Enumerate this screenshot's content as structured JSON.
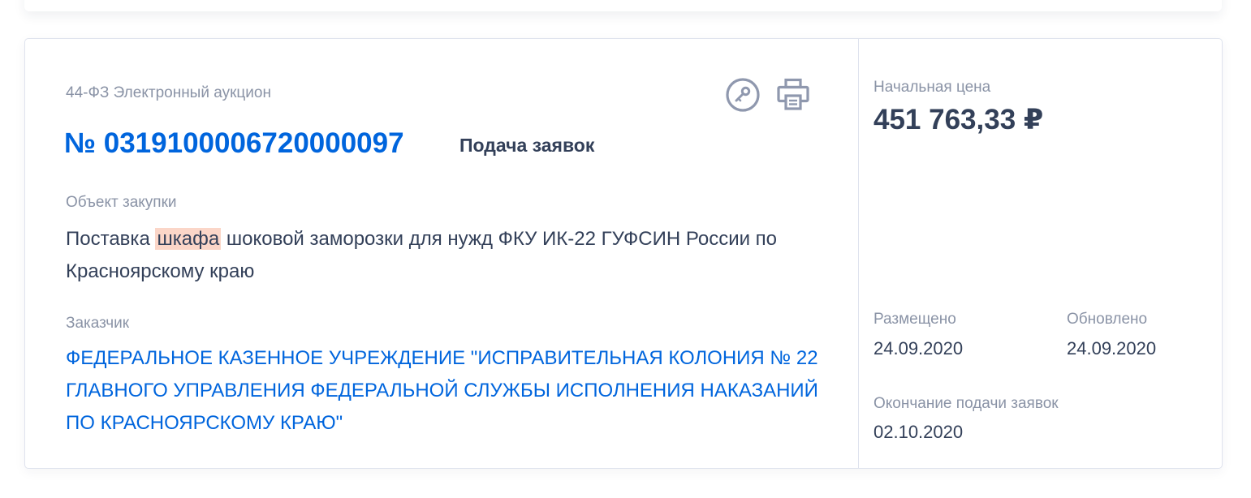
{
  "card": {
    "procurement_type": "44-ФЗ Электронный аукцион",
    "registry_number": "№ 0319100006720000097",
    "status": "Подача заявок",
    "object_label": "Объект закупки",
    "object_text": {
      "before": "Поставка ",
      "highlight": "шкафа",
      "after": " шоковой заморозки для нужд ФКУ ИК-22 ГУФСИН России по Красноярскому краю"
    },
    "customer_label": "Заказчик",
    "customer_name": "ФЕДЕРАЛЬНОЕ КАЗЕННОЕ УЧРЕЖДЕНИЕ \"ИСПРАВИТЕЛЬНАЯ КОЛОНИЯ № 22 ГЛАВНОГО УПРАВЛЕНИЯ ФЕДЕРАЛЬНОЙ СЛУЖБЫ ИСПОЛНЕНИЯ НАКАЗАНИЙ ПО КРАСНОЯРСКОМУ КРАЮ\"",
    "actions": {
      "key_icon": "key-icon",
      "print_icon": "printer-icon"
    }
  },
  "sidebar": {
    "price_label": "Начальная цена",
    "price_value": "451 763,33 ₽",
    "posted_label": "Размещено",
    "posted_value": "24.09.2020",
    "updated_label": "Обновлено",
    "updated_value": "24.09.2020",
    "deadline_label": "Окончание подачи заявок",
    "deadline_value": "02.10.2020"
  },
  "colors": {
    "link": "#0065dd",
    "text": "#334059",
    "muted": "#8a93a6",
    "highlight": "#fbd6c8",
    "icon": "#8f98ae",
    "border": "#dfe3ee"
  }
}
